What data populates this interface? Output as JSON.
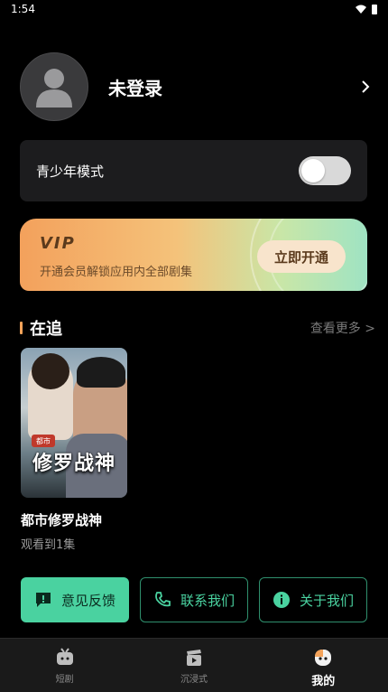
{
  "status": {
    "time": "1:54"
  },
  "profile": {
    "name": "未登录"
  },
  "teen_mode": {
    "label": "青少年模式",
    "enabled": false
  },
  "vip": {
    "title": "VIP",
    "subtitle": "开通会员解锁应用内全部剧集",
    "button": "立即开通"
  },
  "following": {
    "title": "在追",
    "more": "查看更多 >",
    "items": [
      {
        "poster_title": "修罗战神",
        "poster_tag": "都市",
        "name": "都市修罗战神",
        "progress": "观看到1集"
      }
    ]
  },
  "actions": [
    {
      "label": "意见反馈"
    },
    {
      "label": "联系我们"
    },
    {
      "label": "关于我们"
    }
  ],
  "tabs": [
    {
      "label": "短剧"
    },
    {
      "label": "沉浸式"
    },
    {
      "label": "我的"
    }
  ],
  "colors": {
    "accent": "#4ad2a0",
    "vip_orange": "#f3a15c",
    "background": "#000000"
  }
}
